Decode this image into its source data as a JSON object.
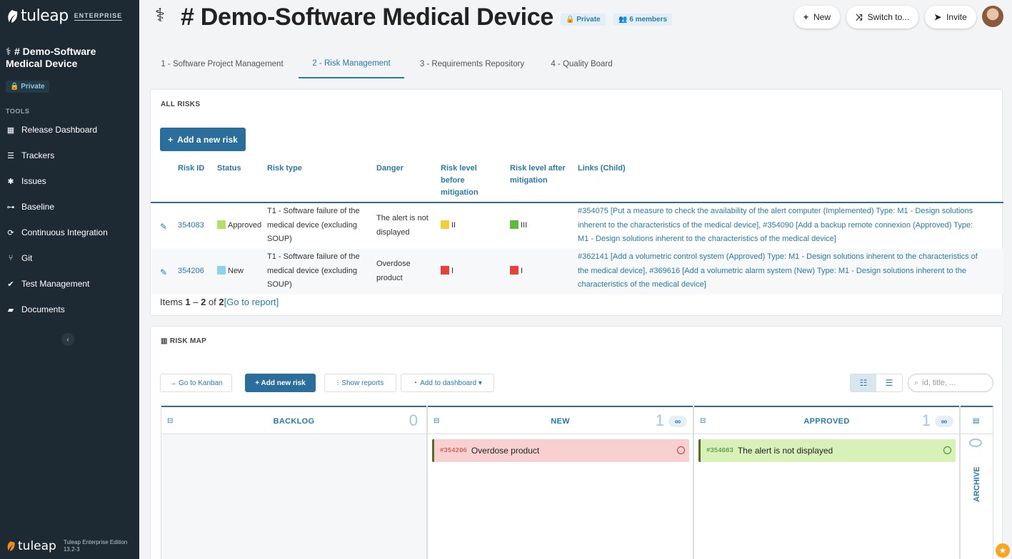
{
  "sidebar": {
    "brand": "tuleap",
    "edition_badge": "ENTERPRISE",
    "project_name": "# Demo-Software Medical Device",
    "project_icon": "caduceus-icon",
    "visibility": "Private",
    "tools_heading": "TOOLS",
    "items": [
      {
        "label": "Release Dashboard",
        "icon": "table-icon"
      },
      {
        "label": "Trackers",
        "icon": "list-icon"
      },
      {
        "label": "Issues",
        "icon": "bug-icon"
      },
      {
        "label": "Baseline",
        "icon": "baseline-icon"
      },
      {
        "label": "Continuous Integration",
        "icon": "refresh-icon"
      },
      {
        "label": "Git",
        "icon": "git-icon"
      },
      {
        "label": "Test Management",
        "icon": "check-icon"
      },
      {
        "label": "Documents",
        "icon": "folder-icon"
      }
    ],
    "footer_brand": "tuleap",
    "footer_edition": "Tuleap Enterprise Edition",
    "footer_version": "13.2-3"
  },
  "header": {
    "title": "# Demo-Software Medical Device",
    "privacy_badge": "Private",
    "members_badge": "6 members",
    "buttons": {
      "new": "New",
      "switch": "Switch to...",
      "invite": "Invite"
    }
  },
  "tabs": [
    {
      "label": "1 - Software Project Management",
      "active": false
    },
    {
      "label": "2 - Risk Management",
      "active": true
    },
    {
      "label": "3 - Requirements Repository",
      "active": false
    },
    {
      "label": "4 - Quality Board",
      "active": false
    }
  ],
  "all_risks": {
    "title": "ALL RISKS",
    "add_button": "Add a new risk",
    "columns": [
      "Risk ID",
      "Status",
      "Risk type",
      "Danger",
      "Risk level before mitigation",
      "Risk level after mitigation",
      "Links (Child)"
    ],
    "rows": [
      {
        "id": "354083",
        "status": "Approved",
        "status_color": "#b3e06a",
        "risk_type": "T1 - Software failure of the medical device (excluding SOUP)",
        "danger": "The alert is not displayed",
        "before": "II",
        "before_color": "#f5cc3a",
        "after": "III",
        "after_color": "#5fba3a",
        "links": [
          "#354075 [Put a measure to check the availability of the alert computer (Implemented) Type: M1 - Design solutions inherent to the characteristics of the medical device]",
          "#354090 [Add a backup remote connexion (Approved) Type: M1 - Design solutions inherent to the characteristics of the medical device]"
        ]
      },
      {
        "id": "354206",
        "status": "New",
        "status_color": "#8dd3ef",
        "risk_type": "T1 - Software failure of the medical device (excluding SOUP)",
        "danger": "Overdose product",
        "before": "I",
        "before_color": "#e8403a",
        "after": "I",
        "after_color": "#e8403a",
        "links": [
          "#362141 [Add a volumetric control system (Approved) Type: M1 - Design solutions inherent to the characteristics of the medical device]",
          "#369616 [Add a volumetric alarm system (New) Type: M1 - Design solutions inherent to the characteristics of the medical device]"
        ]
      }
    ],
    "items_prefix": "Items ",
    "items_range": "1",
    "items_dash": " – ",
    "items_to": "2",
    "items_of": " of ",
    "items_total": "2",
    "report_link": "[Go to report]"
  },
  "risk_map": {
    "title": "RISK MAP",
    "go_kanban": "→ Go to Kanban",
    "add_risk": "+ Add new risk",
    "show_reports": "Show reports",
    "add_dashboard": "Add to dashboard ▾",
    "search_placeholder": "id, title, ...",
    "columns": [
      {
        "label": "BACKLOG",
        "count": "0"
      },
      {
        "label": "NEW",
        "count": "1"
      },
      {
        "label": "APPROVED",
        "count": "1"
      }
    ],
    "cards": [
      {
        "id": "#354206",
        "title": "Overdose product",
        "bg": "#f8d0d0",
        "border": "#5a6b2a",
        "id_color": "#c0392b",
        "clock_color": "#c0392b"
      },
      {
        "id": "#354083",
        "title": "The alert is not displayed",
        "bg": "#d8f1b8",
        "border": "#5a6b2a",
        "id_color": "#3a7a2a",
        "clock_color": "#3a8a2a"
      }
    ],
    "archive_label": "ARCHIVE",
    "infinity": "∞"
  }
}
